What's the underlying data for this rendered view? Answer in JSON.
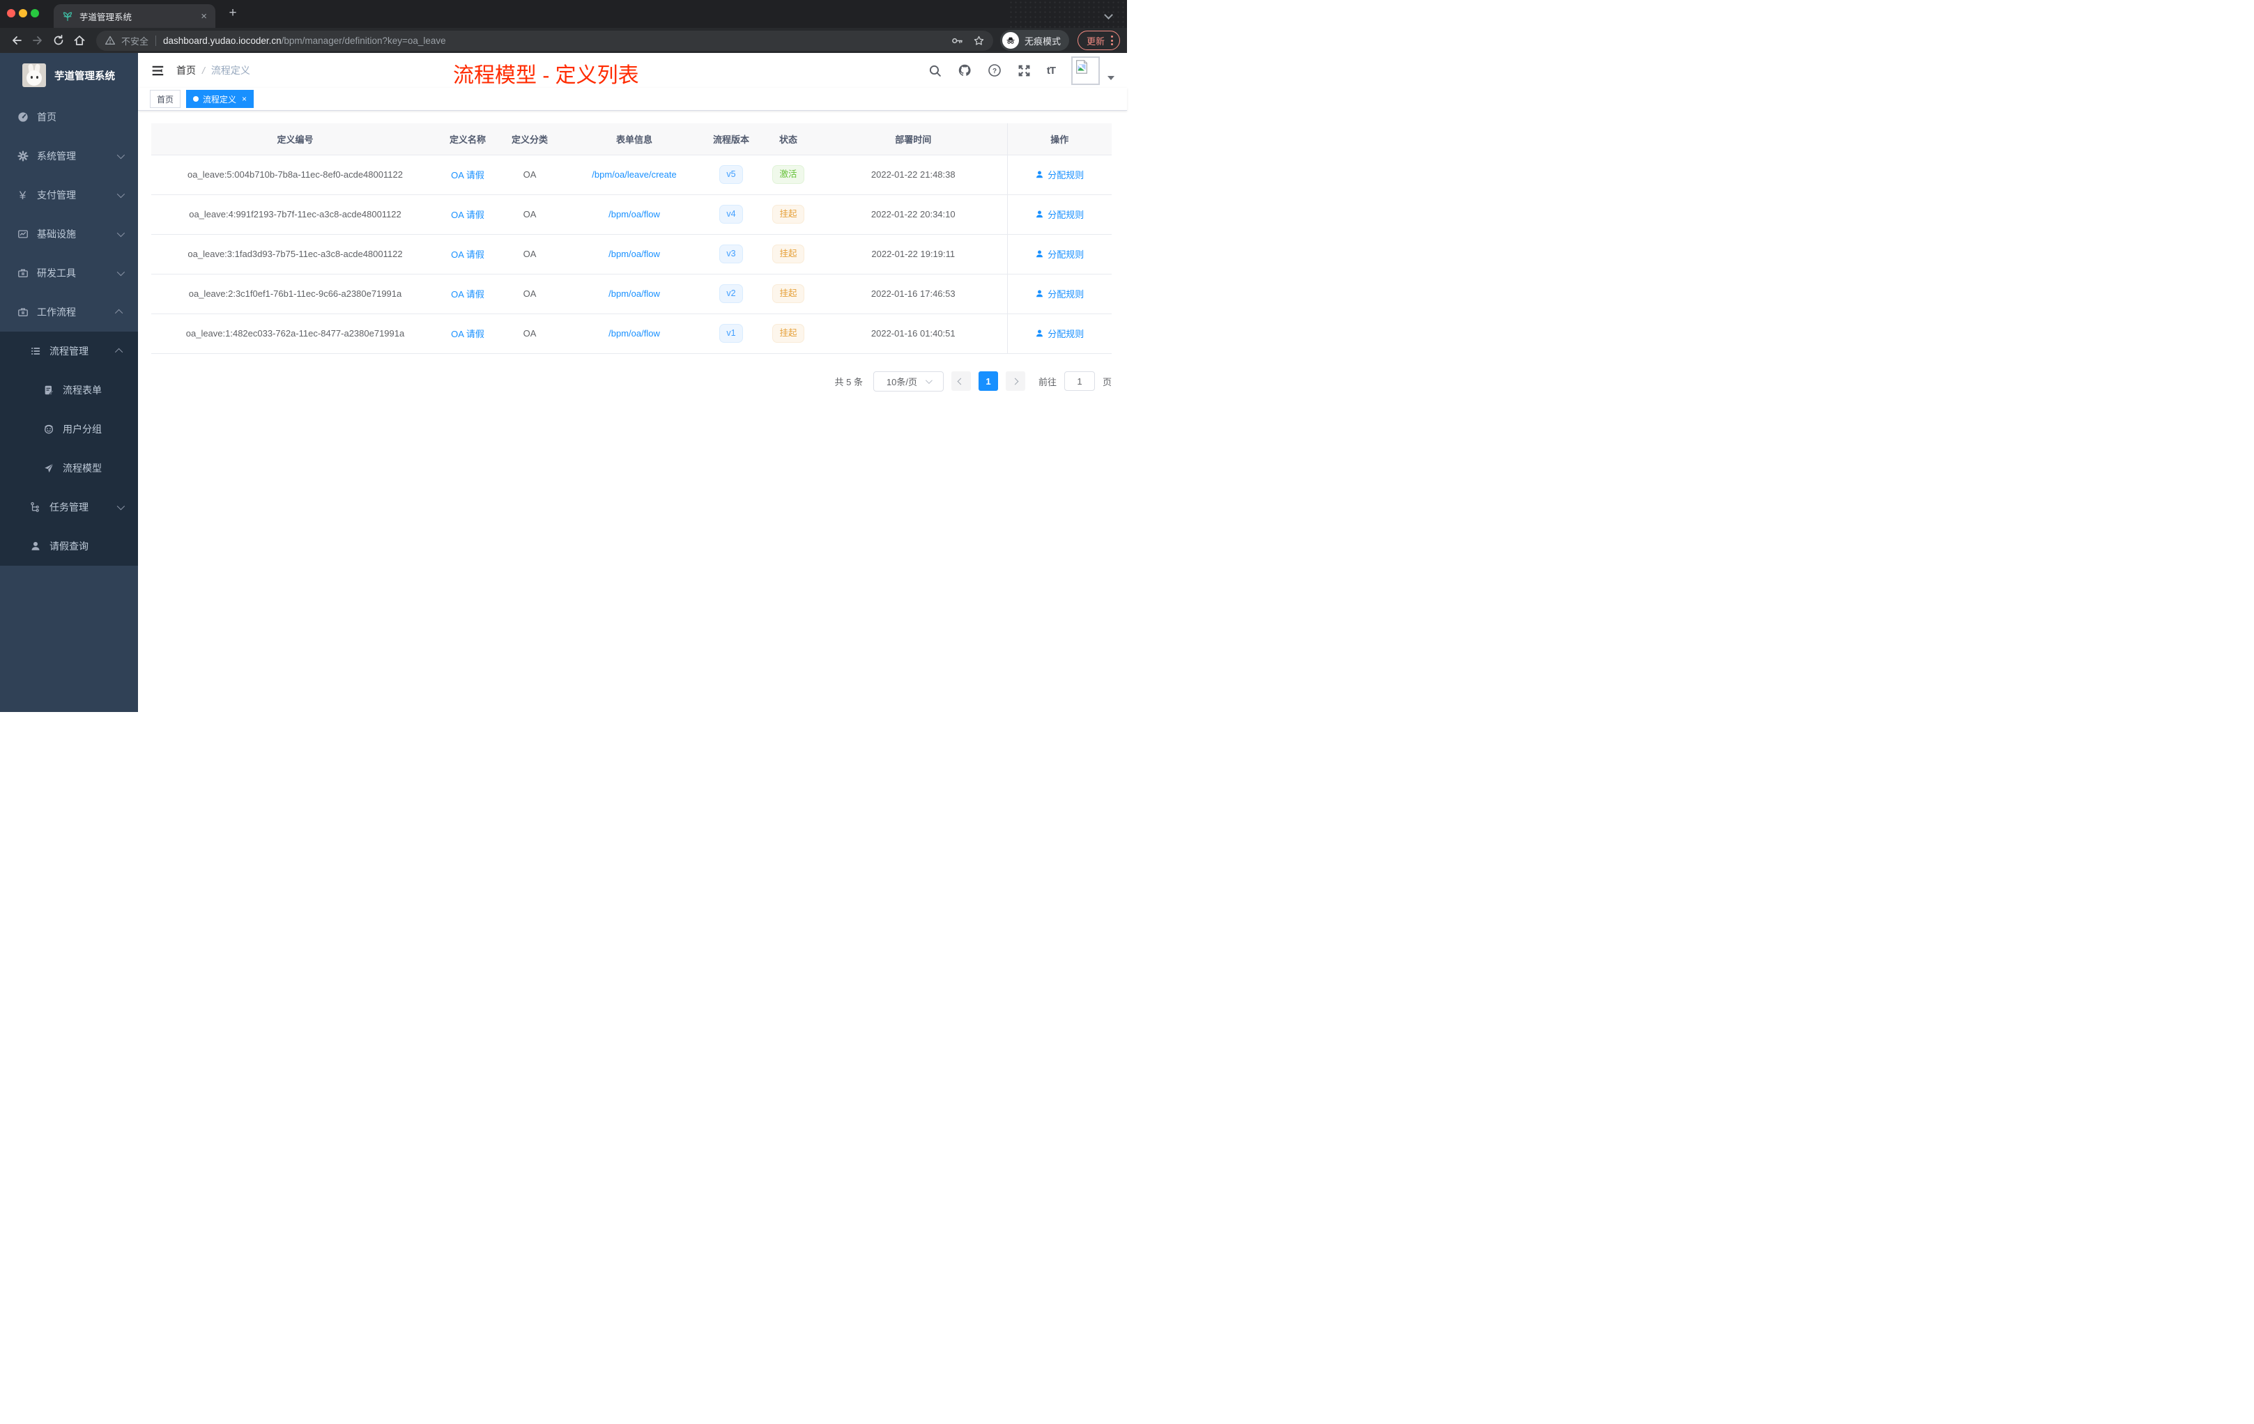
{
  "browser": {
    "tab_title": "芋道管理系统",
    "close_glyph": "×",
    "new_tab_glyph": "+",
    "not_secure_label": "不安全",
    "url_domain": "dashboard.yudao.iocoder.cn",
    "url_path": "/bpm/manager/definition?key=oa_leave",
    "incognito_label": "无痕模式",
    "update_label": "更新"
  },
  "sidebar": {
    "logo_title": "芋道管理系统",
    "items": [
      {
        "label": "首页",
        "icon": "dashboard-icon"
      },
      {
        "label": "系统管理",
        "icon": "gear-icon",
        "chevron": "down"
      },
      {
        "label": "支付管理",
        "icon": "yen-icon",
        "glyph": "¥",
        "chevron": "down"
      },
      {
        "label": "基础设施",
        "icon": "infrastructure-icon",
        "chevron": "down"
      },
      {
        "label": "研发工具",
        "icon": "toolbox-icon",
        "chevron": "down"
      },
      {
        "label": "工作流程",
        "icon": "workflow-icon",
        "chevron": "up"
      },
      {
        "label": "流程管理",
        "icon": "process-list-icon",
        "chevron": "up"
      },
      {
        "label": "流程表单",
        "icon": "form-icon"
      },
      {
        "label": "用户分组",
        "icon": "user-group-icon"
      },
      {
        "label": "流程模型",
        "icon": "paper-plane-icon"
      },
      {
        "label": "任务管理",
        "icon": "task-tree-icon",
        "chevron": "down"
      },
      {
        "label": "请假查询",
        "icon": "person-icon"
      }
    ]
  },
  "header": {
    "breadcrumb_home": "首页",
    "breadcrumb_sep": "/",
    "breadcrumb_current": "流程定义",
    "annotation": "流程模型 - 定义列表",
    "help_glyph": "?",
    "font_size_glyph": "tT"
  },
  "tags": {
    "home": "首页",
    "current": "流程定义",
    "close_glyph": "×"
  },
  "table": {
    "columns": [
      "定义编号",
      "定义名称",
      "定义分类",
      "表单信息",
      "流程版本",
      "状态",
      "部署时间",
      "操作"
    ],
    "rows": [
      {
        "id": "oa_leave:5:004b710b-7b8a-11ec-8ef0-acde48001122",
        "name": "OA 请假",
        "category": "OA",
        "form": "/bpm/oa/leave/create",
        "version": "v5",
        "status": "激活",
        "status_type": "success",
        "deploy_time": "2022-01-22 21:48:38",
        "action": "分配规则"
      },
      {
        "id": "oa_leave:4:991f2193-7b7f-11ec-a3c8-acde48001122",
        "name": "OA 请假",
        "category": "OA",
        "form": "/bpm/oa/flow",
        "version": "v4",
        "status": "挂起",
        "status_type": "warning",
        "deploy_time": "2022-01-22 20:34:10",
        "action": "分配规则"
      },
      {
        "id": "oa_leave:3:1fad3d93-7b75-11ec-a3c8-acde48001122",
        "name": "OA 请假",
        "category": "OA",
        "form": "/bpm/oa/flow",
        "version": "v3",
        "status": "挂起",
        "status_type": "warning",
        "deploy_time": "2022-01-22 19:19:11",
        "action": "分配规则"
      },
      {
        "id": "oa_leave:2:3c1f0ef1-76b1-11ec-9c66-a2380e71991a",
        "name": "OA 请假",
        "category": "OA",
        "form": "/bpm/oa/flow",
        "version": "v2",
        "status": "挂起",
        "status_type": "warning",
        "deploy_time": "2022-01-16 17:46:53",
        "action": "分配规则"
      },
      {
        "id": "oa_leave:1:482ec033-762a-11ec-8477-a2380e71991a",
        "name": "OA 请假",
        "category": "OA",
        "form": "/bpm/oa/flow",
        "version": "v1",
        "status": "挂起",
        "status_type": "warning",
        "deploy_time": "2022-01-16 01:40:51",
        "action": "分配规则"
      }
    ]
  },
  "pagination": {
    "total": "共 5 条",
    "page_size": "10条/页",
    "current_page": "1",
    "goto_label": "前往",
    "goto_value": "1",
    "page_unit": "页"
  },
  "colors": {
    "accent": "#1890ff",
    "success": "#67c23a",
    "warning": "#e6a23c",
    "annotation_red": "#ff2b00",
    "sidebar_bg": "#304156",
    "submenu_bg": "#1f2d3d"
  }
}
